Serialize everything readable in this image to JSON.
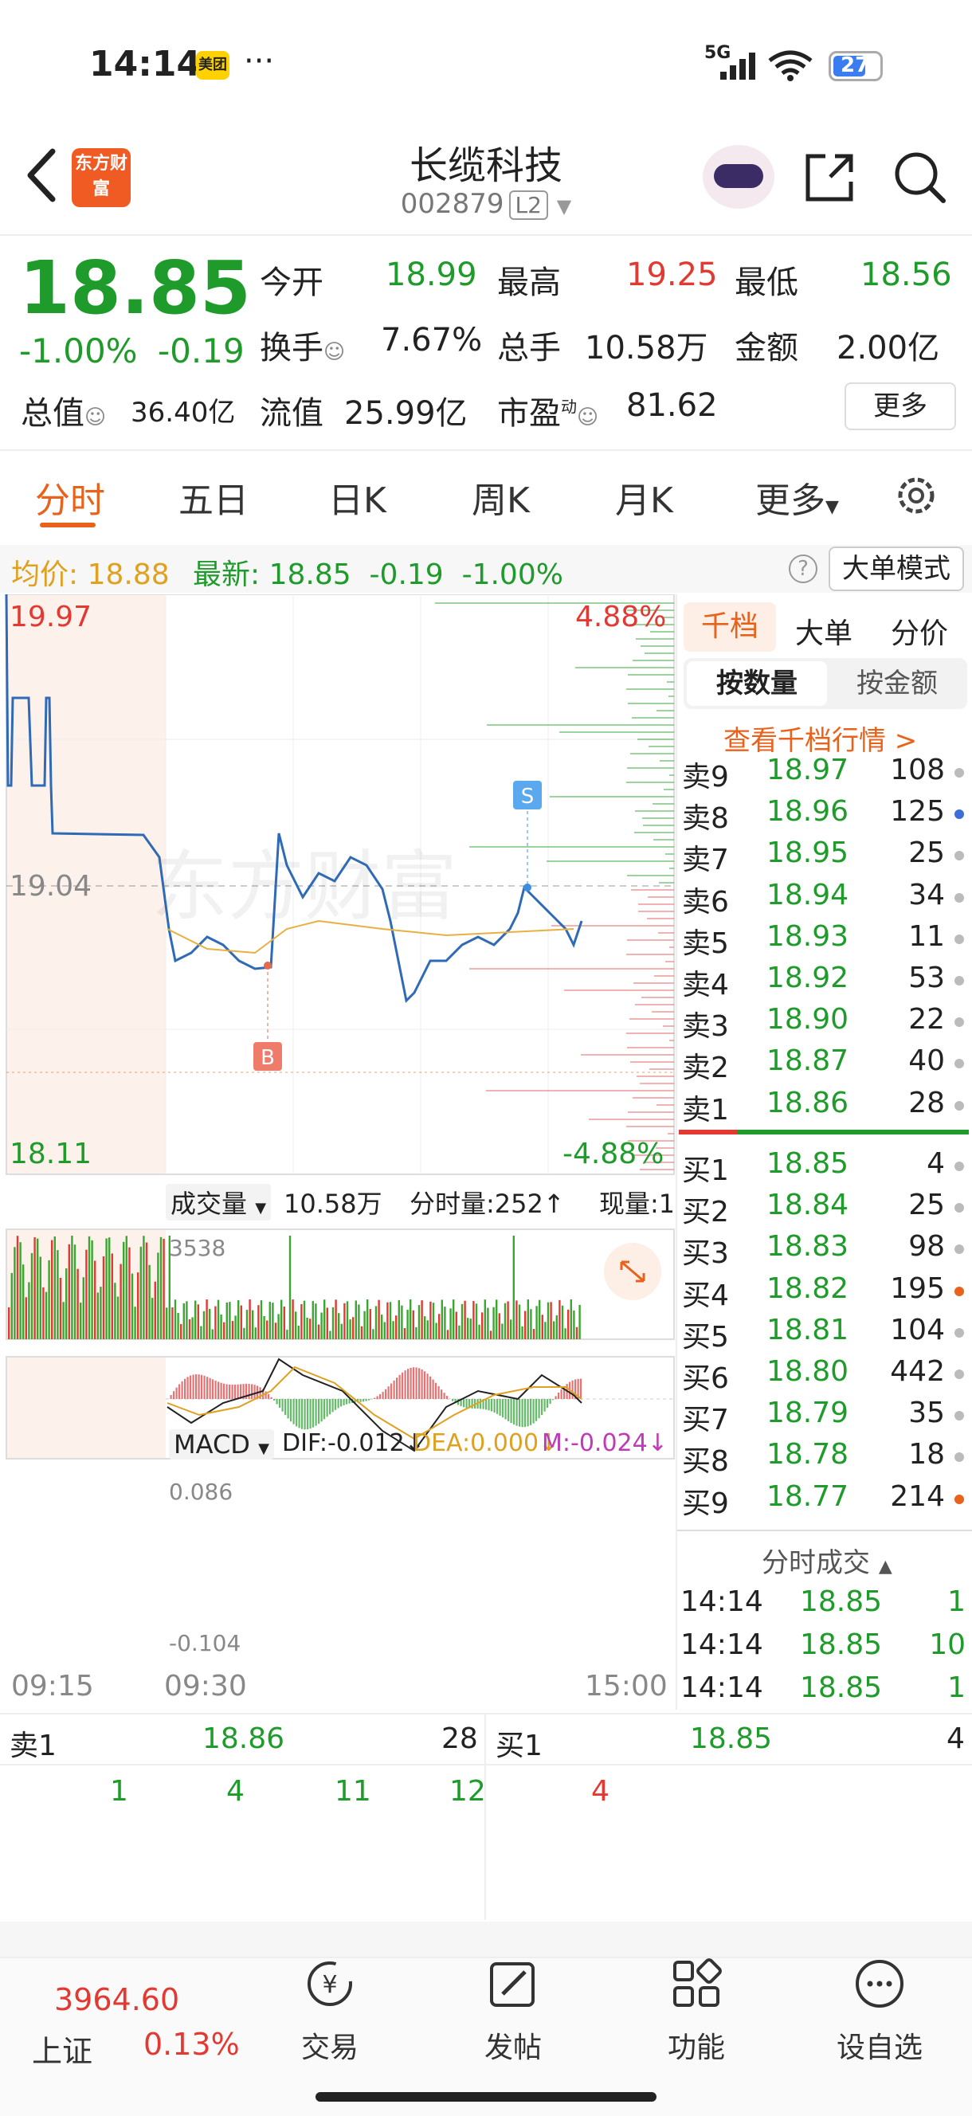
{
  "status_bar": {
    "time": "14:14",
    "app_badge": "美团",
    "dots": "···",
    "network": "5G",
    "battery": "27"
  },
  "header": {
    "logo_text": "东方财富",
    "stock_name": "长缆科技",
    "stock_code": "002879",
    "level": "L2"
  },
  "quote": {
    "price": "18.85",
    "change_pct": "-1.00%",
    "change": "-0.19",
    "open_label": "今开",
    "open": "18.99",
    "high_label": "最高",
    "high": "19.25",
    "low_label": "最低",
    "low": "18.56",
    "turnover_label": "换手",
    "turnover": "7.67%",
    "volume_label": "总手",
    "volume": "10.58万",
    "amount_label": "金额",
    "amount": "2.00亿",
    "mktcap_label": "总值",
    "mktcap": "36.40亿",
    "float_label": "流值",
    "float": "25.99亿",
    "pe_label": "市盈",
    "pe_sup": "动",
    "pe": "81.62",
    "more_label": "更多"
  },
  "tabs": [
    "分时",
    "五日",
    "日K",
    "周K",
    "月K",
    "更多"
  ],
  "infobar": {
    "avg_label": "均价:",
    "avg": "18.88",
    "latest_label": "最新:",
    "latest": "18.85",
    "chg": "-0.19",
    "pct": "-1.00%",
    "mode_label": "大单模式"
  },
  "chart_labels": {
    "y_high": "19.97",
    "y_mid": "19.04",
    "y_low": "18.11",
    "pct_high": "4.88%",
    "pct_low": "-4.88%",
    "watermark": "东方财富",
    "buy_marker": "B",
    "sell_marker": "S",
    "vol_selector": "成交量",
    "vol_total": "10.58万",
    "vol_min": "分时量:252↑",
    "vol_now": "现量:1",
    "vol_max": "3538",
    "macd_selector": "MACD",
    "dif": "DIF:-0.012↓",
    "dea": "DEA:0.000↓",
    "m": "M:-0.024↓",
    "macd_max": "0.086",
    "macd_min": "-0.104",
    "time_start": "09:15",
    "time_open": "09:30",
    "time_end": "15:00"
  },
  "right_panel": {
    "tabs": [
      "千档",
      "大单",
      "分价"
    ],
    "seg_on": "按数量",
    "seg_off": "按金额",
    "view_link": "查看千档行情 >",
    "asks": [
      {
        "label": "卖9",
        "price": "18.97",
        "vol": "108"
      },
      {
        "label": "卖8",
        "price": "18.96",
        "vol": "125"
      },
      {
        "label": "卖7",
        "price": "18.95",
        "vol": "25"
      },
      {
        "label": "卖6",
        "price": "18.94",
        "vol": "34"
      },
      {
        "label": "卖5",
        "price": "18.93",
        "vol": "11"
      },
      {
        "label": "卖4",
        "price": "18.92",
        "vol": "53"
      },
      {
        "label": "卖3",
        "price": "18.90",
        "vol": "22"
      },
      {
        "label": "卖2",
        "price": "18.87",
        "vol": "40"
      },
      {
        "label": "卖1",
        "price": "18.86",
        "vol": "28"
      }
    ],
    "bids": [
      {
        "label": "买1",
        "price": "18.85",
        "vol": "4"
      },
      {
        "label": "买2",
        "price": "18.84",
        "vol": "25"
      },
      {
        "label": "买3",
        "price": "18.83",
        "vol": "98"
      },
      {
        "label": "买4",
        "price": "18.82",
        "vol": "195"
      },
      {
        "label": "买5",
        "price": "18.81",
        "vol": "104"
      },
      {
        "label": "买6",
        "price": "18.80",
        "vol": "442"
      },
      {
        "label": "买7",
        "price": "18.79",
        "vol": "35"
      },
      {
        "label": "买8",
        "price": "18.78",
        "vol": "18"
      },
      {
        "label": "买9",
        "price": "18.77",
        "vol": "214"
      }
    ],
    "ticks_title": "分时成交",
    "ticks": [
      {
        "time": "14:14",
        "price": "18.85",
        "vol": "1"
      },
      {
        "time": "14:14",
        "price": "18.85",
        "vol": "10"
      },
      {
        "time": "14:14",
        "price": "18.85",
        "vol": "1"
      }
    ]
  },
  "level1": {
    "ask_label": "卖1",
    "ask_price": "18.86",
    "ask_vol": "28",
    "bid_label": "买1",
    "bid_price": "18.85",
    "bid_vol": "4",
    "ask_queue": [
      "1",
      "4",
      "11",
      "12"
    ],
    "bid_queue": [
      "4"
    ]
  },
  "bottom_nav": {
    "index_value": "3964.60",
    "index_name": "上证",
    "index_pct": "0.13%",
    "items": [
      "交易",
      "发帖",
      "功能",
      "设自选"
    ]
  }
}
